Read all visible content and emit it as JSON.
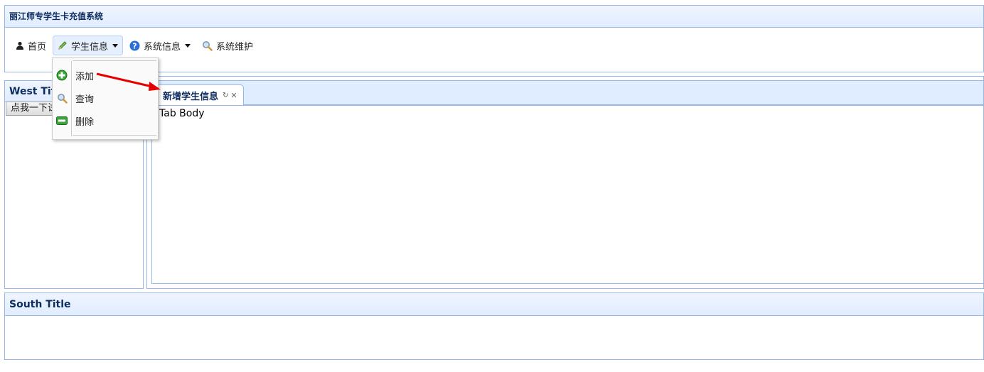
{
  "north": {
    "title": "丽江师专学生卡充值系统",
    "menu": [
      {
        "label": "首页",
        "icon": "user-icon"
      },
      {
        "label": "学生信息",
        "icon": "pencil-icon",
        "has_dropdown": true
      },
      {
        "label": "系统信息",
        "icon": "help-icon",
        "has_dropdown": true
      },
      {
        "label": "系统维护",
        "icon": "search-icon"
      }
    ]
  },
  "dropdown": {
    "items": [
      {
        "label": "添加",
        "icon": "add-icon"
      },
      {
        "label": "查询",
        "icon": "search-icon"
      },
      {
        "label": "删除",
        "icon": "remove-icon"
      }
    ]
  },
  "west": {
    "title": "West Title",
    "button_label": "点我一下试试"
  },
  "center": {
    "tab_title": "新增学生信息",
    "tab_body": "Tab Body"
  },
  "south": {
    "title": "South Title"
  },
  "colors": {
    "header_bg": "#e0ecff",
    "border": "#95b8e7",
    "title_text": "#0e2d5f",
    "annotation_arrow": "#e60000"
  }
}
